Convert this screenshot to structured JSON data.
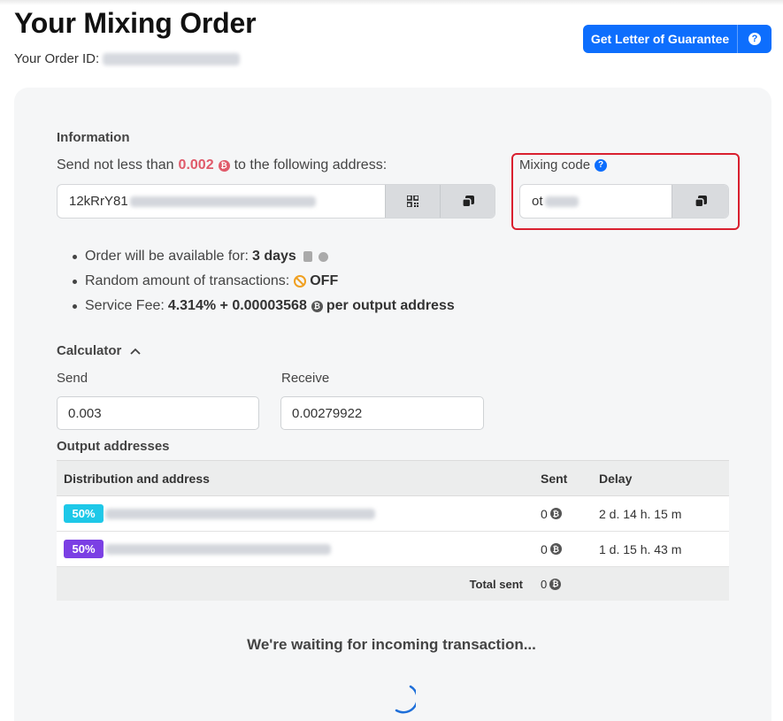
{
  "header": {
    "title": "Your Mixing Order",
    "order_id_label": "Your Order ID:",
    "guarantee_button": "Get Letter of Guarantee",
    "help_symbol": "?"
  },
  "information": {
    "heading": "Information",
    "send_prefix": "Send not less than",
    "min_amount": "0.002",
    "send_suffix": "to the following address:",
    "address_prefix": "12kRrY81",
    "btc_symbol": "₿"
  },
  "mixing_code": {
    "label": "Mixing code",
    "help_symbol": "?",
    "value_prefix": "ot"
  },
  "details": {
    "availability_label": "Order will be available for:",
    "availability_value": "3 days",
    "random_label": "Random amount of transactions:",
    "random_value": "OFF",
    "fee_label": "Service Fee:",
    "fee_value": "4.314% + 0.00003568",
    "fee_suffix": "per output address"
  },
  "calculator": {
    "heading": "Calculator",
    "send_label": "Send",
    "send_value": "0.003",
    "receive_label": "Receive",
    "receive_value": "0.00279922"
  },
  "outputs": {
    "heading": "Output addresses",
    "columns": {
      "address": "Distribution and address",
      "sent": "Sent",
      "delay": "Delay"
    },
    "rows": [
      {
        "percent": "50%",
        "badge_color": "#1ec8e8",
        "sent": "0",
        "delay": "2 d. 14 h. 15 m"
      },
      {
        "percent": "50%",
        "badge_color": "#7b3fe4",
        "sent": "0",
        "delay": "1 d. 15 h. 43 m"
      }
    ],
    "total_label": "Total sent",
    "total_value": "0"
  },
  "status": {
    "waiting_text": "We're waiting for incoming transaction..."
  },
  "colors": {
    "accent": "#0d6efd",
    "highlight_border": "#d9202f",
    "min_amount": "#e05a6a",
    "off_icon": "#f0a020"
  }
}
